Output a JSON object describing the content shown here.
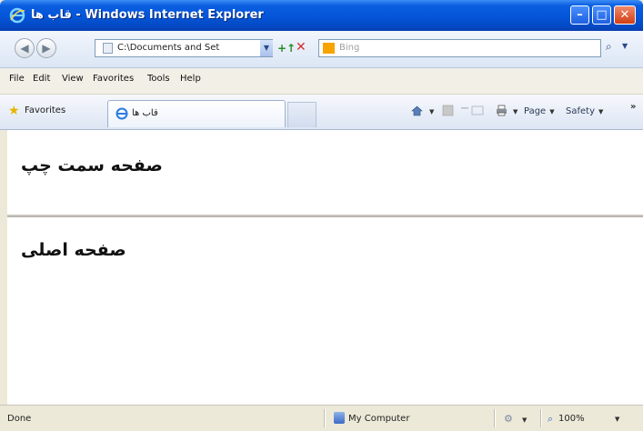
{
  "window": {
    "title": "قاب ها - Windows Internet Explorer",
    "minimize_glyph": "–",
    "maximize_glyph": "□",
    "close_glyph": "✕"
  },
  "address_bar": {
    "url": "C:\\Documents and Set",
    "search_placeholder": "Bing",
    "back_glyph": "◀",
    "forward_glyph": "▶",
    "refresh_glyph": "+↑",
    "stop_glyph": "✕",
    "search_glyph": "⌕",
    "dropdown_glyph": "▼"
  },
  "menu": {
    "items": [
      {
        "label": "File"
      },
      {
        "label": "Edit"
      },
      {
        "label": "View"
      },
      {
        "label": "Favorites"
      },
      {
        "label": "Tools"
      },
      {
        "label": "Help"
      }
    ]
  },
  "favorites_bar": {
    "favorites_label": "Favorites",
    "tab_label": "قاب ها",
    "page_menu": "Page",
    "safety_menu": "Safety",
    "more_glyph": "»",
    "arrow_glyph": "▼"
  },
  "frames": {
    "top_heading": "صفحه سمت چپ",
    "bottom_heading": "صفحه اصلی"
  },
  "status_bar": {
    "status": "Done",
    "zone": "My Computer",
    "zoom": "100%",
    "arrow_glyph": "▼"
  },
  "colors": {
    "titlebar": "#0555d8",
    "frame_background": "#ffffff",
    "chrome": "#ece9d8"
  }
}
